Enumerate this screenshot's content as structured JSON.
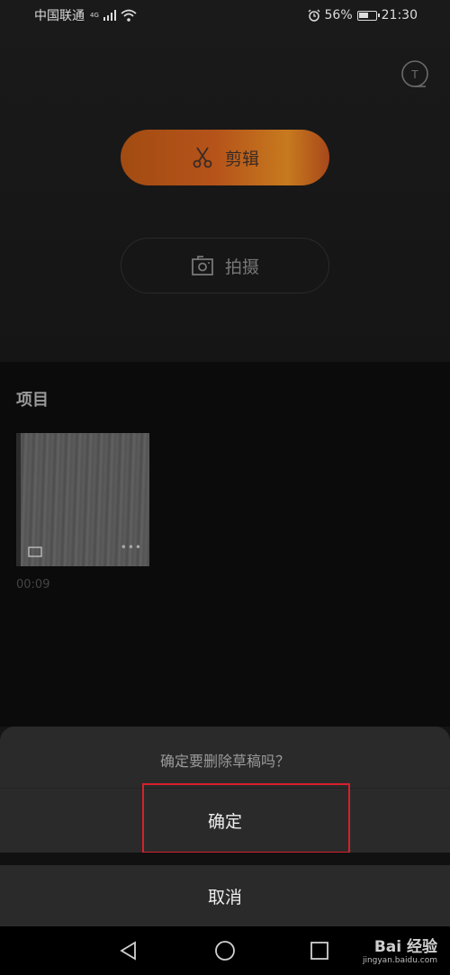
{
  "status_bar": {
    "carrier": "中国联通",
    "network": "4G",
    "battery_percent": "56%",
    "battery_level": 0.56,
    "time": "21:30",
    "icons": [
      "signal-icon",
      "wifi-icon",
      "alarm-icon",
      "battery-icon"
    ]
  },
  "main": {
    "tutorial_icon_letter": "T",
    "edit_label": "剪辑",
    "shoot_label": "拍摄"
  },
  "projects": {
    "title": "项目",
    "drafts": [
      {
        "duration": "00:09",
        "more": "•••"
      }
    ]
  },
  "dialog": {
    "question": "确定要删除草稿吗？",
    "confirm_label": "确定",
    "cancel_label": "取消",
    "highlight_color": "#d7202c"
  },
  "watermark": {
    "text": "Bai 经验",
    "site": "jingyan.baidu.com"
  },
  "colors": {
    "accent_orange": "#b5531a",
    "background": "#141414",
    "sheet": "#2a2a2a"
  }
}
